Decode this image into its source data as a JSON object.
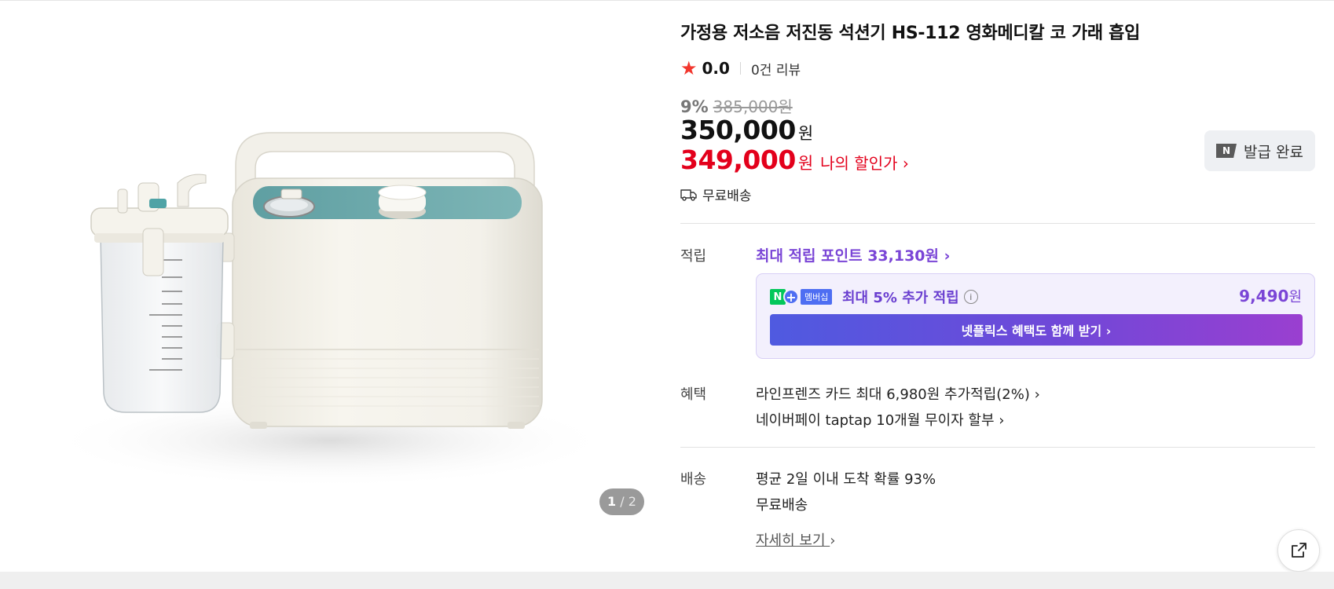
{
  "product": {
    "title": "가정용 저소음 저진동 석션기 HS-112 영화메디칼 코 가래 흡입",
    "rating_score": "0.0",
    "review_count": "0건 리뷰",
    "discount_pct": "9%",
    "original_price": "385,000원",
    "price": "350,000",
    "price_unit": "원",
    "my_price": "349,000",
    "my_price_unit": "원",
    "my_price_link": "나의 할인가 ›",
    "shipping": "무료배송"
  },
  "gallery": {
    "current_page": "1",
    "separator": "/",
    "total_pages": "2"
  },
  "coupon": {
    "badge": "N",
    "label": "발급 완료"
  },
  "points": {
    "label": "적립",
    "link": "최대 적립 포인트 33,130원 ›",
    "membership_badge_n": "N",
    "membership_badge_plus": "+",
    "membership_badge_text": "멤버십",
    "extra": "최대 5% 추가 적립",
    "info_icon": "i",
    "amount": "9,490",
    "amount_unit": "원",
    "cta": "넷플릭스 혜택도 함께 받기 ›"
  },
  "benefits": {
    "label": "혜택",
    "items": [
      "라인프렌즈 카드 최대 6,980원 추가적립(2%) ›",
      "네이버페이 taptap 10개월 무이자 할부 ›"
    ]
  },
  "delivery": {
    "label": "배송",
    "line1": "평균 2일 이내 도착 확률 93%",
    "line2": "무료배송",
    "detail_link": "자세히 보기",
    "detail_chevron": "›"
  },
  "icons": {
    "star": "star-icon",
    "truck": "truck-icon",
    "share": "share-icon"
  },
  "colors": {
    "sale_red": "#e3001b",
    "points_purple": "#7a45d6",
    "star_red": "#f2362d",
    "naver_green": "#03c75a"
  }
}
